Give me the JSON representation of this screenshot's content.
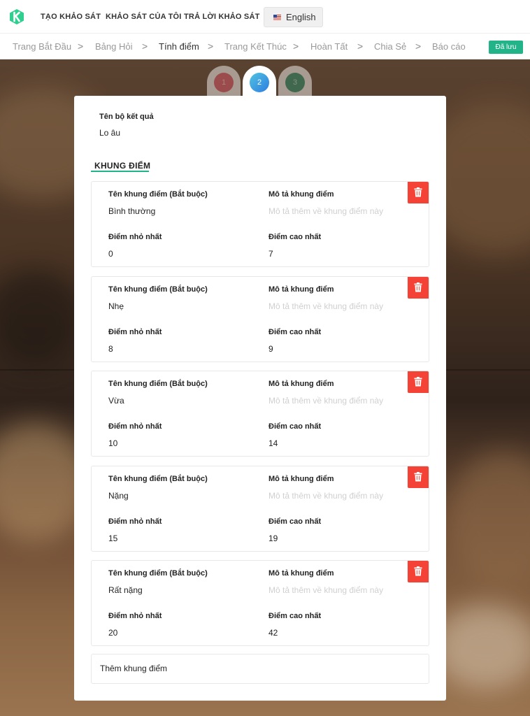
{
  "colors": {
    "accent": "#23b389",
    "danger": "#f44336",
    "step1": "#d25566",
    "step2_from": "#4fc3e0",
    "step2_to": "#2f7de1",
    "step3": "#2d8a6a"
  },
  "topnav": {
    "create": "TẠO KHẢO SÁT",
    "mine": "KHẢO SÁT CỦA TÔI",
    "answer": "TRẢ LỜI KHẢO SÁT",
    "language": "English",
    "language_icon": "us-flag-icon"
  },
  "breadcrumb": {
    "items": [
      "Trang Bắt Đầu",
      "Bảng Hỏi",
      "Tính điểm",
      "Trang Kết Thúc",
      "Hoàn Tất",
      "Chia Sẻ",
      "Báo cáo"
    ],
    "active_index": 2,
    "separator": ">",
    "saved_label": "Đã lưu"
  },
  "steps": [
    "1",
    "2",
    "3"
  ],
  "active_step": 2,
  "result_set": {
    "label": "Tên bộ kết quả",
    "value": "Lo âu"
  },
  "section_title": "KHUNG ĐIỂM",
  "field_labels": {
    "name": "Tên khung điểm (Bắt buộc)",
    "description": "Mô tả khung điểm",
    "min": "Điểm nhỏ nhất",
    "max": "Điểm cao nhất",
    "description_placeholder": "Mô tả thêm về khung điểm này"
  },
  "ranges": [
    {
      "name": "Bình thường",
      "min": "0",
      "max": "7"
    },
    {
      "name": "Nhẹ",
      "min": "8",
      "max": "9"
    },
    {
      "name": "Vừa",
      "min": "10",
      "max": "14"
    },
    {
      "name": "Nặng",
      "min": "15",
      "max": "19"
    },
    {
      "name": "Rất nặng",
      "min": "20",
      "max": "42"
    }
  ],
  "add_range_label": "Thêm khung điểm"
}
